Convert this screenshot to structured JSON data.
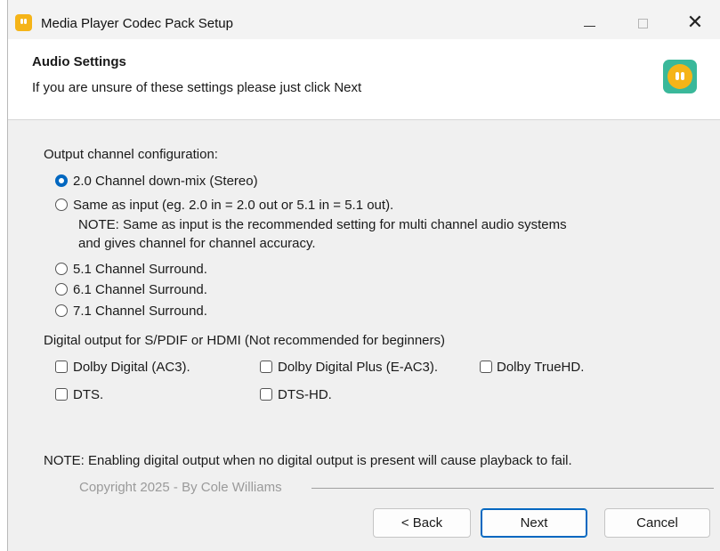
{
  "window": {
    "title": "Media Player Codec Pack Setup",
    "close_glyph": "✕"
  },
  "header": {
    "title": "Audio Settings",
    "subtitle": "If you are unsure of these settings please just click Next"
  },
  "output": {
    "group_label": "Output channel configuration:",
    "options": [
      {
        "label": "2.0 Channel down-mix (Stereo)",
        "checked": true
      },
      {
        "label": "Same as input (eg. 2.0 in = 2.0 out or 5.1 in = 5.1 out).",
        "checked": false
      },
      {
        "label": "5.1 Channel Surround.",
        "checked": false
      },
      {
        "label": "6.1 Channel Surround.",
        "checked": false
      },
      {
        "label": "7.1 Channel Surround.",
        "checked": false
      }
    ],
    "note_line1": "NOTE: Same as input is the recommended setting for multi channel audio systems",
    "note_line2": "and gives channel for channel accuracy."
  },
  "digital": {
    "group_label": "Digital output for S/PDIF or HDMI (Not recommended for beginners)",
    "options": [
      {
        "label": "Dolby Digital (AC3).",
        "checked": false
      },
      {
        "label": "Dolby Digital Plus (E-AC3).",
        "checked": false
      },
      {
        "label": "Dolby TrueHD.",
        "checked": false
      },
      {
        "label": "DTS.",
        "checked": false
      },
      {
        "label": "DTS-HD.",
        "checked": false
      }
    ]
  },
  "footer": {
    "note": "NOTE: Enabling digital output when no digital output is present will cause playback to fail.",
    "copyright": "Copyright 2025 - By Cole Williams"
  },
  "buttons": {
    "back": "< Back",
    "next": "Next",
    "cancel": "Cancel"
  },
  "colors": {
    "accent": "#0067c0",
    "logo_yellow": "#f5b418",
    "logo_green": "#3ab89a"
  },
  "icons": {
    "app": "media-player-logo-icon",
    "minimize": "minimize-icon",
    "maximize": "maximize-icon",
    "close": "close-icon"
  }
}
